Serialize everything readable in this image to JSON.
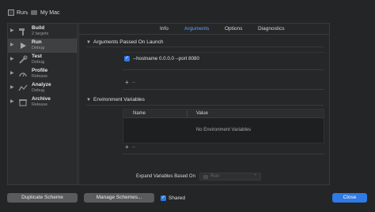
{
  "breadcrumb": {
    "scheme": "Run",
    "destination": "My Mac"
  },
  "sidebar": {
    "items": [
      {
        "title": "Build",
        "subtitle": "2 targets",
        "icon": "hammer-icon",
        "selected": false
      },
      {
        "title": "Run",
        "subtitle": "Debug",
        "icon": "play-icon",
        "selected": true
      },
      {
        "title": "Test",
        "subtitle": "Debug",
        "icon": "wrench-icon",
        "selected": false
      },
      {
        "title": "Profile",
        "subtitle": "Release",
        "icon": "profile-gauge-icon",
        "selected": false
      },
      {
        "title": "Analyze",
        "subtitle": "Debug",
        "icon": "analyze-icon",
        "selected": false
      },
      {
        "title": "Archive",
        "subtitle": "Release",
        "icon": "archive-box-icon",
        "selected": false
      }
    ]
  },
  "tabs": [
    {
      "label": "Info",
      "active": false
    },
    {
      "label": "Arguments",
      "active": true
    },
    {
      "label": "Options",
      "active": false
    },
    {
      "label": "Diagnostics",
      "active": false
    }
  ],
  "arguments_section": {
    "title": "Arguments Passed On Launch",
    "items": [
      {
        "checked": true,
        "value": "--hostname 0.0.0.0 --port 8080"
      }
    ],
    "add_symbol": "+",
    "remove_symbol": "−"
  },
  "env_section": {
    "title": "Environment Variables",
    "columns": [
      "Name",
      "Value"
    ],
    "empty_message": "No Environment Variables",
    "add_symbol": "+",
    "remove_symbol": "−"
  },
  "expand": {
    "label": "Expand Variables Based On",
    "selected": "Run",
    "enabled": false
  },
  "footer": {
    "duplicate_label": "Duplicate Scheme",
    "manage_label": "Manage Schemes...",
    "shared_label": "Shared",
    "shared_checked": true,
    "close_label": "Close"
  },
  "colors": {
    "accent": "#2f7ae5",
    "active_tab": "#5aa2f5",
    "background": "#242526"
  }
}
